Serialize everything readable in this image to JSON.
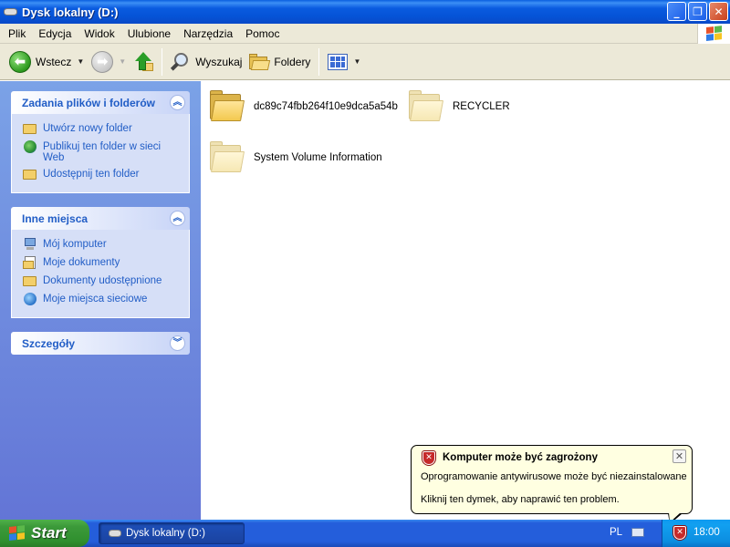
{
  "window": {
    "title": "Dysk lokalny (D:)",
    "buttons": {
      "minimize": "_",
      "maximize": "❐",
      "close": "✕"
    }
  },
  "menu": [
    "Plik",
    "Edycja",
    "Widok",
    "Ulubione",
    "Narzędzia",
    "Pomoc"
  ],
  "toolbar": {
    "back": "Wstecz",
    "search": "Wyszukaj",
    "folders": "Foldery"
  },
  "tasks_panel": {
    "title": "Zadania plików i folderów",
    "collapse_glyph": "︽",
    "items": [
      "Utwórz nowy folder",
      "Publikuj ten folder w sieci Web",
      "Udostępnij ten folder"
    ]
  },
  "places_panel": {
    "title": "Inne miejsca",
    "collapse_glyph": "︽",
    "items": [
      "Mój komputer",
      "Moje dokumenty",
      "Dokumenty udostępnione",
      "Moje miejsca sieciowe"
    ]
  },
  "details_panel": {
    "title": "Szczegóły",
    "expand_glyph": "︾"
  },
  "files": [
    {
      "name": "dc89c74fbb264f10e9dca5a54b",
      "hidden": false
    },
    {
      "name": "RECYCLER",
      "hidden": true
    },
    {
      "name": "System Volume Information",
      "hidden": true
    }
  ],
  "balloon": {
    "title": "Komputer może być zagrożony",
    "line1": "Oprogramowanie antywirusowe może być niezainstalowane",
    "line2": "Kliknij ten dymek, aby naprawić ten problem.",
    "close": "✕"
  },
  "taskbar": {
    "start": "Start",
    "task_button": "Dysk lokalny (D:)",
    "language": "PL",
    "clock": "18:00"
  },
  "colors": {
    "titlebar": "#0553d6",
    "taskbar": "#245edb",
    "task_link": "#215dc6",
    "balloon_bg": "#ffffe1",
    "start_green": "#3c9a3a"
  },
  "icons": {
    "toolbar": [
      "back-arrow-icon",
      "forward-arrow-icon",
      "up-folder-icon",
      "search-icon",
      "folders-icon",
      "views-icon"
    ],
    "tray": [
      "security-alert-icon"
    ]
  }
}
